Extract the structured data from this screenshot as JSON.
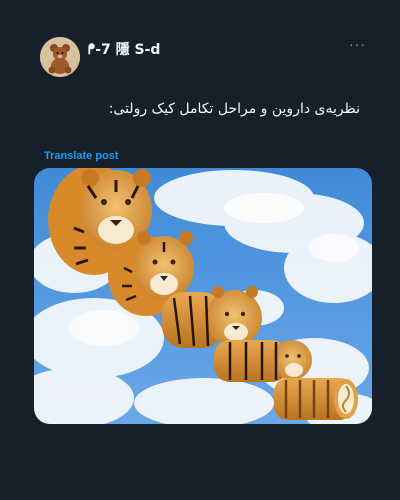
{
  "post": {
    "author_name": "ᖰ-7 隱 S-d",
    "more_label": "···",
    "text": "نظریه‌ی داروین و مراحل تکامل کیک رولتی:",
    "translate_label": "Translate post"
  },
  "icons": {
    "avatar": "teddy-bear-icon",
    "more": "more-options-icon"
  },
  "colors": {
    "background": "#15202b",
    "text": "#f7f9f9",
    "link": "#1d9bf0",
    "muted": "#8b98a5"
  }
}
